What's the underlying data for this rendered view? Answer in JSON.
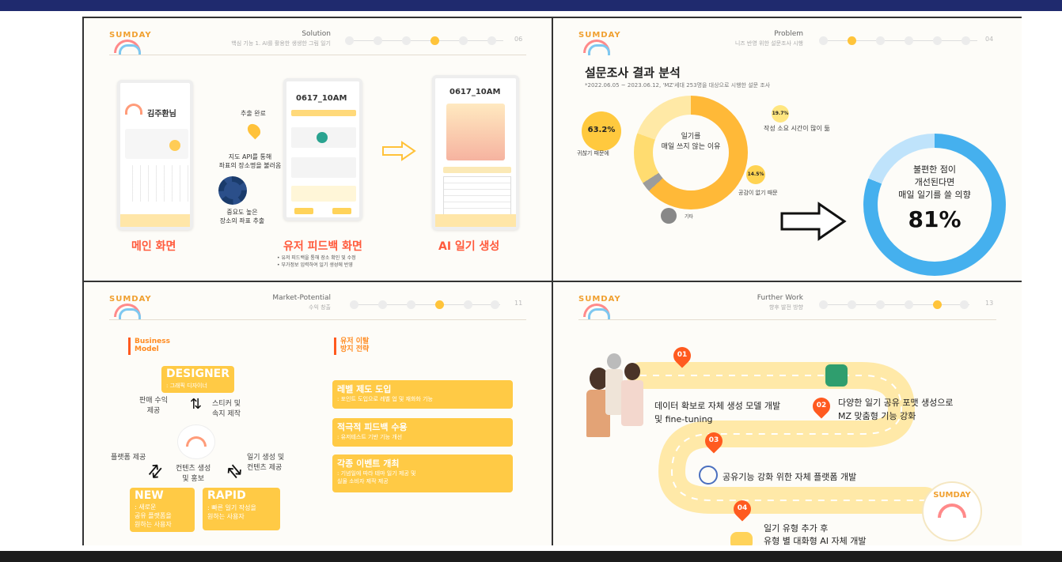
{
  "slide1": {
    "logo": "SUMDAY",
    "title": "Solution",
    "subtitle": "핵심 기능 1. AI를 활용한 생생한 그림 일기",
    "page": "06",
    "phone1": {
      "name": "김주환님",
      "caption": "메인 화면"
    },
    "phone2": {
      "time": "0617_10AM",
      "caption": "유저 피드백 화면"
    },
    "phone3": {
      "time": "0617_10AM",
      "caption": "AI 일기 생성"
    },
    "extract_done": "추출 완료",
    "map_api": "지도 API를 통해\n좌표의 장소명을 불러옴",
    "coords": "중요도 높은\n장소의 좌표 추출",
    "bullets": [
      "유저 피드백을 통해 장소 확인 및 수정",
      "부가정보 입력하여 일기 생성에 반영"
    ]
  },
  "slide2": {
    "logo": "SUMDAY",
    "title": "Problem",
    "subtitle": "니즈 반영 위한 설문조사 시행",
    "page": "04",
    "heading": "설문조사 결과 분석",
    "note": "*2022.06.05 ~ 2023.06.12, 'MZ'세대 253명을 대상으로 시행한 설문 조사",
    "donut_center": "일기를\n매일 쓰지 않는 이유",
    "p1_value": "63.2%",
    "p1_label": "귀찮기 때문에",
    "p2_value": "19.7%",
    "p2_label": "작성 소요 시간이 많이 듦",
    "p3_value": "14.5%",
    "p3_label": "공감이 없기 때문",
    "p4_label": "기타",
    "ring_text": "불편한 점이\n개선된다면\n매일 일기를 쓸 의향",
    "ring_value": "81%"
  },
  "slide3": {
    "logo": "SUMDAY",
    "title": "Market-Potential",
    "subtitle": "수익 창출",
    "page": "11",
    "bm_label": "Business\nModel",
    "designer": "DESIGNER",
    "designer_sub": ": 그래픽 디자이너",
    "sales_fee": "판매 수익\n제공",
    "sticker": "스티커 및\n속지 제작",
    "platform_fee": "플랫폼 제공",
    "content_promo": "컨텐츠 생성\n및 홍보",
    "diary_content": "일기 생성 및\n컨텐츠 제공",
    "new_title": "NEW",
    "new_sub": ": 새로운\n공유 플랫폼을\n원하는 사용자",
    "rapid_title": "RAPID",
    "rapid_sub": ": 빠른 일기 작성을\n원하는 사용자",
    "strategy_label": "유저 이탈\n방지 전략",
    "strategies": [
      {
        "title": "레벨 제도 도입",
        "sub": ": 포인트 도입으로 레벨 업 및 재화화 기능"
      },
      {
        "title": "적극적 피드백 수용",
        "sub": ": 유저테스트 기반 기능 개선"
      },
      {
        "title": "각종 이벤트 개최",
        "sub": ": 기념일에 따라 테마 일기 제공 및\n실물 소비자 제작 제공"
      }
    ]
  },
  "slide4": {
    "logo": "SUMDAY",
    "title": "Further Work",
    "subtitle": "향후 발전 방향",
    "page": "13",
    "steps": [
      {
        "num": "01",
        "text": "데이터 확보로 자체 생성 모델 개발\n및 fine-tuning"
      },
      {
        "num": "02",
        "text": "다양한 일기 공유 포맷 생성으로\nMZ 맞춤형 기능 강화"
      },
      {
        "num": "03",
        "text": "공유기능 강화 위한 자체 플랫폼 개발"
      },
      {
        "num": "04",
        "text": "일기 유형 추가 후\n유형 별 대화형 AI 자체 개발"
      }
    ],
    "badge": "SUMDAY"
  }
}
